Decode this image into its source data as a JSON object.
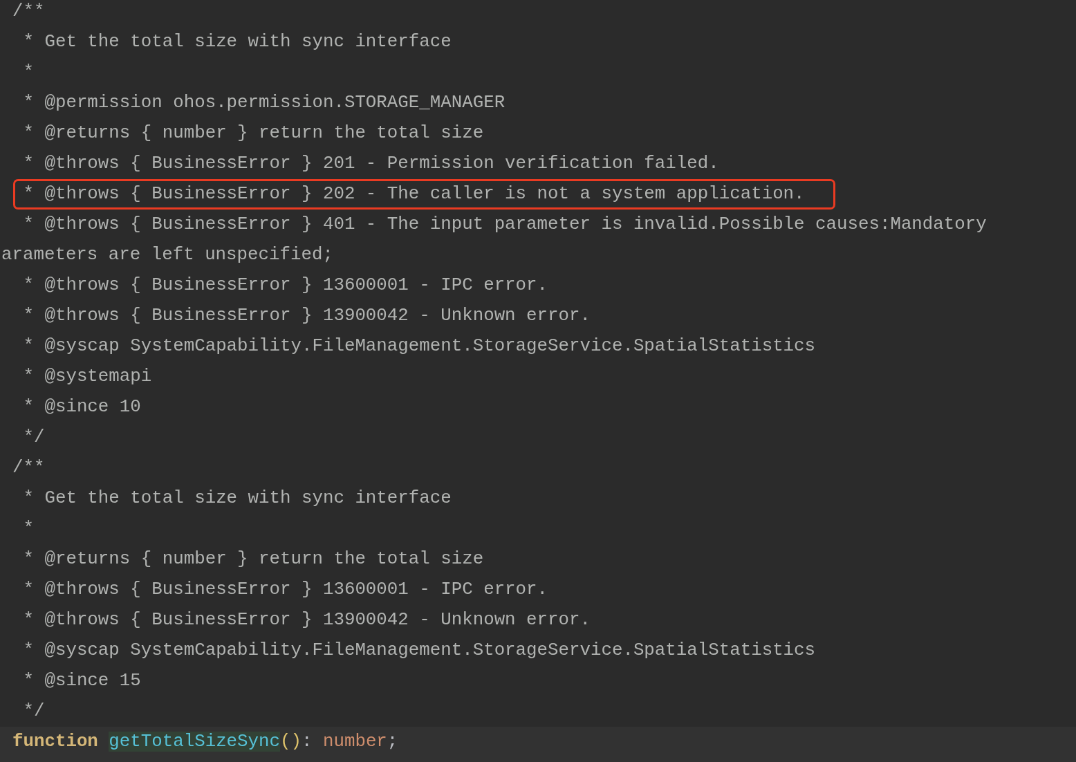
{
  "editor": {
    "lines": [
      {
        "kind": "comment",
        "text": "/**",
        "boxed": false
      },
      {
        "kind": "comment",
        "text": " * Get the total size with sync interface",
        "boxed": false
      },
      {
        "kind": "comment",
        "text": " *",
        "boxed": false
      },
      {
        "kind": "comment",
        "text": " * @permission ohos.permission.STORAGE_MANAGER",
        "boxed": false
      },
      {
        "kind": "comment",
        "text": " * @returns { number } return the total size",
        "boxed": false
      },
      {
        "kind": "comment",
        "text": " * @throws { BusinessError } 201 - Permission verification failed.",
        "boxed": false
      },
      {
        "kind": "comment",
        "text": " * @throws { BusinessError } 202 - The caller is not a system application.",
        "boxed": true
      },
      {
        "kind": "comment",
        "text": " * @throws { BusinessError } 401 - The input parameter is invalid.Possible causes:Mandatory",
        "boxed": false
      },
      {
        "kind": "wrapped",
        "text": "arameters are left unspecified;",
        "boxed": false
      },
      {
        "kind": "comment",
        "text": " * @throws { BusinessError } 13600001 - IPC error.",
        "boxed": false
      },
      {
        "kind": "comment",
        "text": " * @throws { BusinessError } 13900042 - Unknown error.",
        "boxed": false
      },
      {
        "kind": "comment",
        "text": " * @syscap SystemCapability.FileManagement.StorageService.SpatialStatistics",
        "boxed": false
      },
      {
        "kind": "comment",
        "text": " * @systemapi",
        "boxed": false
      },
      {
        "kind": "comment",
        "text": " * @since 10",
        "boxed": false
      },
      {
        "kind": "comment",
        "text": " */",
        "boxed": false
      },
      {
        "kind": "comment",
        "text": "/**",
        "boxed": false
      },
      {
        "kind": "comment",
        "text": " * Get the total size with sync interface",
        "boxed": false
      },
      {
        "kind": "comment",
        "text": " *",
        "boxed": false
      },
      {
        "kind": "comment",
        "text": " * @returns { number } return the total size",
        "boxed": false
      },
      {
        "kind": "comment",
        "text": " * @throws { BusinessError } 13600001 - IPC error.",
        "boxed": false
      },
      {
        "kind": "comment",
        "text": " * @throws { BusinessError } 13900042 - Unknown error.",
        "boxed": false
      },
      {
        "kind": "comment",
        "text": " * @syscap SystemCapability.FileManagement.StorageService.SpatialStatistics",
        "boxed": false
      },
      {
        "kind": "comment",
        "text": " * @since 15",
        "boxed": false
      },
      {
        "kind": "comment",
        "text": " */",
        "boxed": false
      }
    ],
    "code_line": {
      "current": true,
      "tokens": [
        {
          "kind": "keyword",
          "text": "function"
        },
        {
          "kind": "function",
          "text": "getTotalSizeSync"
        },
        {
          "kind": "paren",
          "text": "()"
        },
        {
          "kind": "punct",
          "text": ": "
        },
        {
          "kind": "type",
          "text": "number"
        },
        {
          "kind": "semicolon",
          "text": ";"
        }
      ]
    }
  }
}
